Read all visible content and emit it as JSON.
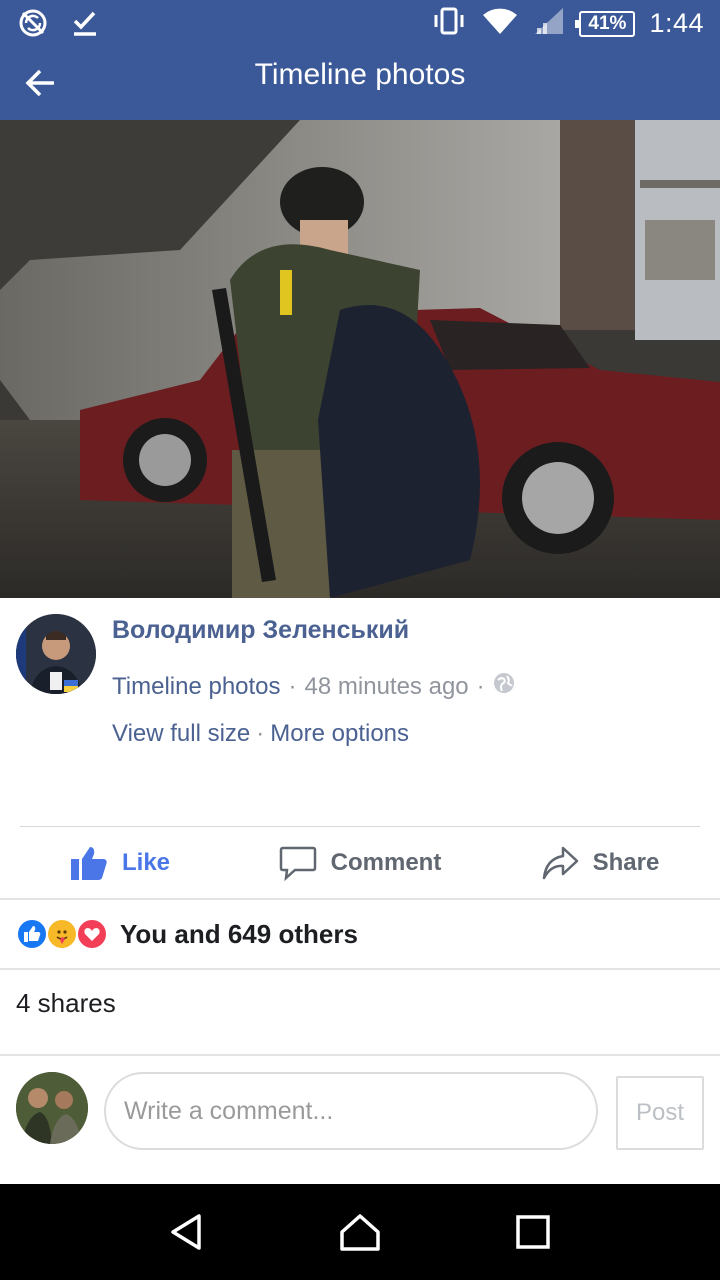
{
  "status_bar": {
    "time": "1:44",
    "battery": "41%",
    "icons": [
      "no-sync-icon",
      "check-icon",
      "vibrate-icon",
      "wifi-icon",
      "signal-icon",
      "battery-icon"
    ]
  },
  "app_bar": {
    "title": "Timeline photos",
    "back_icon": "arrow-left-icon"
  },
  "post": {
    "author": "Володимир Зеленський",
    "album": "Timeline photos",
    "separator": "·",
    "time": "48 minutes ago",
    "privacy_icon": "globe-icon",
    "view_full_size": "View full size",
    "more_options": "More options"
  },
  "actions": {
    "like": "Like",
    "comment": "Comment",
    "share": "Share"
  },
  "reactions": {
    "types": [
      "like",
      "care",
      "love"
    ],
    "summary": "You and 649 others"
  },
  "shares": {
    "text": "4 shares"
  },
  "composer": {
    "placeholder": "Write a comment...",
    "post_label": "Post"
  },
  "colors": {
    "brand": "#3b5998",
    "link": "#4b6191",
    "like_blue": "#4a76e8"
  }
}
